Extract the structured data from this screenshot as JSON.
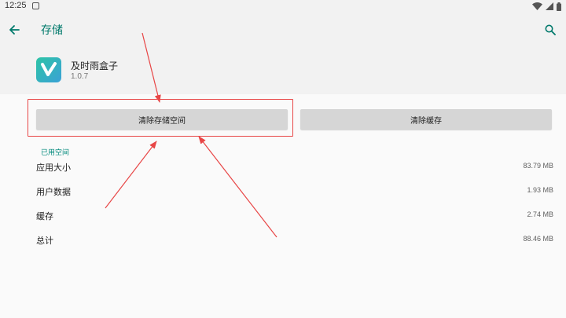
{
  "status_bar": {
    "time": "12:25",
    "notification_icon": "notification-square-icon",
    "wifi_icon": "wifi-icon",
    "signal_icon": "cell-signal-icon",
    "battery_icon": "battery-icon"
  },
  "app_bar": {
    "title": "存储",
    "back_icon": "arrow-back-icon",
    "search_icon": "search-icon"
  },
  "app": {
    "name": "及时雨盒子",
    "version": "1.0.7",
    "icon": "app-logo-icon"
  },
  "buttons": {
    "clear_storage": "清除存储空间",
    "clear_cache": "清除缓存"
  },
  "space": {
    "section_title": "已用空间",
    "rows": [
      {
        "label": "应用大小",
        "value": "83.79 MB"
      },
      {
        "label": "用户数据",
        "value": "1.93 MB"
      },
      {
        "label": "缓存",
        "value": "2.74 MB"
      },
      {
        "label": "总计",
        "value": "88.46 MB"
      }
    ]
  },
  "colors": {
    "accent": "#00796b",
    "annotation": "#e84646",
    "button": "#d6d6d6"
  }
}
